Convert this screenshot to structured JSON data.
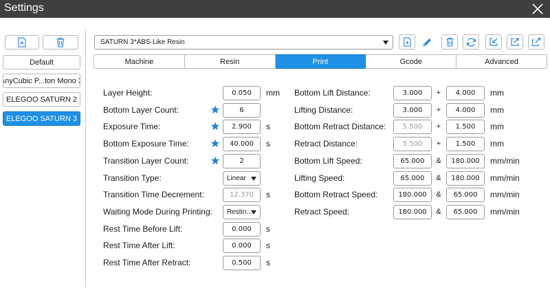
{
  "window": {
    "title": "Settings"
  },
  "sidebar": {
    "printers": [
      {
        "label": "Default",
        "active": false
      },
      {
        "label": "AnyCubic P...ton Mono X",
        "active": false
      },
      {
        "label": "ELEGOO SATURN 2",
        "active": false
      },
      {
        "label": "ELEGOO SATURN 3",
        "active": true
      }
    ]
  },
  "profile": {
    "selected": "SATURN 3*ABS-Like Resin"
  },
  "tabs": [
    "Machine",
    "Resin",
    "Print",
    "Gcode",
    "Advanced"
  ],
  "active_tab": "Print",
  "left_settings": [
    {
      "label": "Layer Height:",
      "value": "0.050",
      "unit": "mm",
      "star": false,
      "dim": false
    },
    {
      "label": "Bottom Layer Count:",
      "value": "6",
      "unit": "",
      "star": true,
      "dim": false
    },
    {
      "label": "Exposure Time:",
      "value": "2.900",
      "unit": "s",
      "star": true,
      "dim": false
    },
    {
      "label": "Bottom Exposure Time:",
      "value": "40.000",
      "unit": "s",
      "star": true,
      "dim": false
    },
    {
      "label": "Transition Layer Count:",
      "value": "2",
      "unit": "",
      "star": true,
      "dim": false
    },
    {
      "label": "Transition Type:",
      "value": "Linear",
      "unit": "",
      "star": false,
      "dim": false
    },
    {
      "label": "Transition Time Decrement:",
      "value": "12.370",
      "unit": "s",
      "star": false,
      "dim": true
    },
    {
      "label": "Waiting Mode During Printing:",
      "value": "Restin...",
      "unit": "",
      "star": false,
      "dim": false
    },
    {
      "label": "Rest Time Before Lift:",
      "value": "0.000",
      "unit": "s",
      "star": false,
      "dim": false
    },
    {
      "label": "Rest Time After Lift:",
      "value": "0.000",
      "unit": "s",
      "star": false,
      "dim": false
    },
    {
      "label": "Rest Time After Retract:",
      "value": "0.500",
      "unit": "s",
      "star": false,
      "dim": false
    }
  ],
  "right_settings": [
    {
      "label": "Bottom Lift Distance:",
      "value1": "3.000",
      "op": "+",
      "value2": "4.000",
      "unit": "mm",
      "dim1": false
    },
    {
      "label": "Lifting Distance:",
      "value1": "3.000",
      "op": "+",
      "value2": "4.000",
      "unit": "mm",
      "dim1": false
    },
    {
      "label": "Bottom Retract Distance:",
      "value1": "5.500",
      "op": "+",
      "value2": "1.500",
      "unit": "mm",
      "dim1": true
    },
    {
      "label": "Retract Distance:",
      "value1": "5.500",
      "op": "+",
      "value2": "1.500",
      "unit": "mm",
      "dim1": true
    },
    {
      "label": "Bottom Lift Speed:",
      "value1": "65.000",
      "op": "&",
      "value2": "180.000",
      "unit": "mm/min",
      "dim1": false
    },
    {
      "label": "Lifting Speed:",
      "value1": "65.000",
      "op": "&",
      "value2": "180.000",
      "unit": "mm/min",
      "dim1": false
    },
    {
      "label": "Bottom Retract Speed:",
      "value1": "180.000",
      "op": "&",
      "value2": "65.000",
      "unit": "mm/min",
      "dim1": false
    },
    {
      "label": "Retract Speed:",
      "value1": "180.000",
      "op": "&",
      "value2": "65.000",
      "unit": "mm/min",
      "dim1": false
    }
  ],
  "toolbar_icons": [
    "new-file-icon",
    "edit-pencil-icon",
    "delete-trash-icon",
    "refresh-icon",
    "import-icon",
    "export-icon",
    "copy-icon"
  ],
  "colors": {
    "accent": "#1e90e6",
    "titlebar": "#3f3f3f",
    "icon": "#2a8be0"
  }
}
